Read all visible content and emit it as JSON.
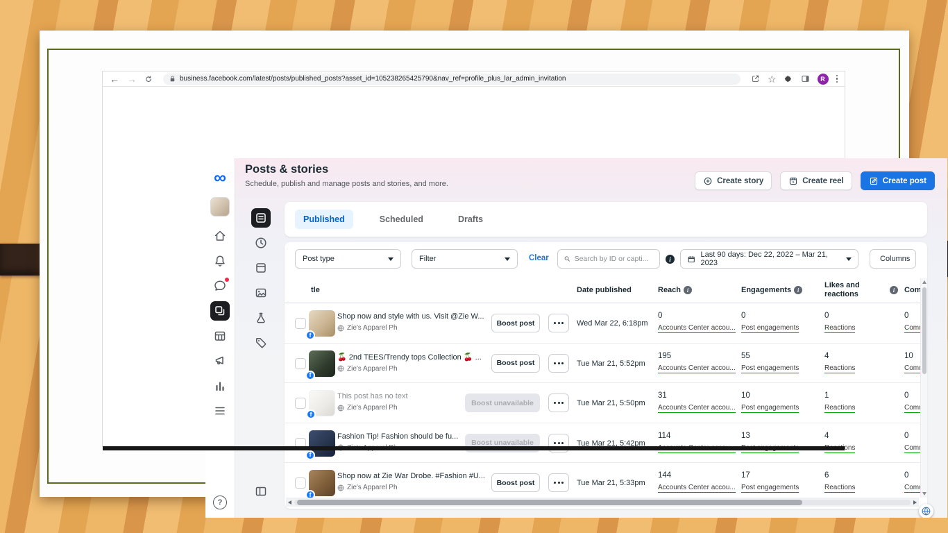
{
  "browser": {
    "url": "business.facebook.com/latest/posts/published_posts?asset_id=105238265425790&nav_ref=profile_plus_lar_admin_invitation",
    "profile_initial": "R"
  },
  "app": {
    "title": "Posts & stories",
    "subtitle": "Schedule, publish and manage posts and stories, and more.",
    "actions": {
      "create_story": "Create story",
      "create_reel": "Create reel",
      "create_post": "Create post"
    },
    "tabs": {
      "published": "Published",
      "scheduled": "Scheduled",
      "drafts": "Drafts"
    },
    "filters": {
      "post_type": "Post type",
      "filter": "Filter",
      "clear": "Clear",
      "search_placeholder": "Search by ID or capti...",
      "date_range": "Last 90 days: Dec 22, 2022 – Mar 21, 2023",
      "columns": "Columns"
    },
    "sidebar": {
      "primary_icons": [
        "home",
        "notifications",
        "inbox",
        "posts",
        "planner",
        "ads",
        "insights",
        "more"
      ],
      "secondary_icons": [
        "posts",
        "scheduled",
        "planner",
        "content",
        "testing",
        "tags"
      ],
      "help": "?"
    },
    "table": {
      "headers": {
        "title": "tle",
        "date": "Date published",
        "reach": "Reach",
        "engagements": "Engagements",
        "likes": "Likes and reactions",
        "comments": "Com"
      },
      "rows": [
        {
          "title": "Shop now and style with us. Visit @Zie W...",
          "page": "Zie's Apparel Ph",
          "boost": "Boost post",
          "date": "Wed Mar 22, 6:18pm",
          "reach": "0",
          "reach_sub": "Accounts Center accou...",
          "engagements": "0",
          "engagements_sub": "Post engagements",
          "likes": "0",
          "likes_sub": "Reactions",
          "comments": "0",
          "comments_sub": "Comm..."
        },
        {
          "title": "🍒 2nd TEES/Trendy tops Collection 🍒 ...",
          "page": "Zie's Apparel Ph",
          "boost": "Boost post",
          "date": "Tue Mar 21, 5:52pm",
          "reach": "195",
          "reach_sub": "Accounts Center accou...",
          "engagements": "55",
          "engagements_sub": "Post engagements",
          "likes": "4",
          "likes_sub": "Reactions",
          "comments": "10",
          "comments_sub": "Comm..."
        },
        {
          "title": "This post has no text",
          "page": "Zie's Apparel Ph",
          "boost": "Boost unavailable",
          "date": "Tue Mar 21, 5:50pm",
          "reach": "31",
          "reach_sub": "Accounts Center accou...",
          "engagements": "10",
          "engagements_sub": "Post engagements",
          "likes": "1",
          "likes_sub": "Reactions",
          "comments": "0",
          "comments_sub": "Comm..."
        },
        {
          "title": "Fashion Tip! Fashion should be fu...",
          "page": "Zie's Apparel Ph",
          "boost": "Boost unavailable",
          "date": "Tue Mar 21, 5:42pm",
          "reach": "114",
          "reach_sub": "Accounts Center accou...",
          "engagements": "13",
          "engagements_sub": "Post engagements",
          "likes": "4",
          "likes_sub": "Reactions",
          "comments": "0",
          "comments_sub": "Comm..."
        },
        {
          "title": "Shop now at Zie War Drobe. #Fashion #U...",
          "page": "Zie's Apparel Ph",
          "boost": "Boost post",
          "date": "Tue Mar 21, 5:33pm",
          "reach": "144",
          "reach_sub": "Accounts Center accou...",
          "engagements": "17",
          "engagements_sub": "Post engagements",
          "likes": "6",
          "likes_sub": "Reactions",
          "comments": "0",
          "comments_sub": "Comm..."
        }
      ]
    },
    "colors": {
      "accent_blue": "#1b74e4",
      "tab_active_blue": "#0064d1",
      "facebook_blue": "#1877f2",
      "metric_link_green": "#00a400",
      "meta_logo_blue": "#0866ff",
      "slide_border_green": "#5a6b1f"
    }
  }
}
